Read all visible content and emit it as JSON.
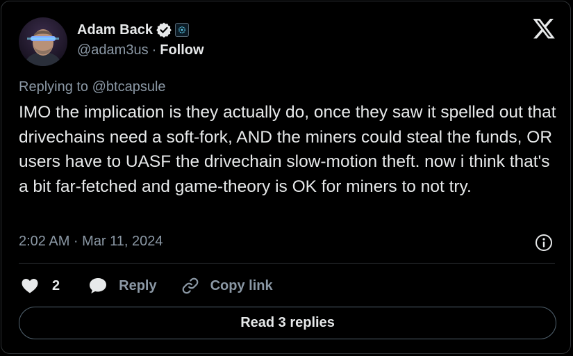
{
  "author": {
    "display_name": "Adam Back",
    "handle": "@adam3us",
    "separator": "·",
    "follow_label": "Follow"
  },
  "tweet": {
    "reply_context": "Replying to @btcapsule",
    "text": "IMO the implication is they actually do, once they saw it spelled out that drivechains need a soft-fork, AND the miners could steal the funds, OR users have to UASF the drivechain slow-motion theft. now i think that's a bit far-fetched and game-theory is OK for miners to not try.",
    "timestamp": "2:02 AM · Mar 11, 2024"
  },
  "actions": {
    "like_count": "2",
    "reply_label": "Reply",
    "copy_link_label": "Copy link"
  },
  "read_replies_label": "Read 3 replies",
  "icons": {
    "brand": "x-logo-icon",
    "verified": "verified-badge-icon",
    "affiliate": "affiliate-badge-icon",
    "info": "info-icon",
    "like": "heart-icon",
    "reply": "speech-bubble-icon",
    "copy_link": "link-icon"
  },
  "colors": {
    "background": "#000000",
    "text_primary": "#e7e9ea",
    "text_secondary": "#8b98a5",
    "border": "#2f3336",
    "like_red": "#f91880"
  }
}
